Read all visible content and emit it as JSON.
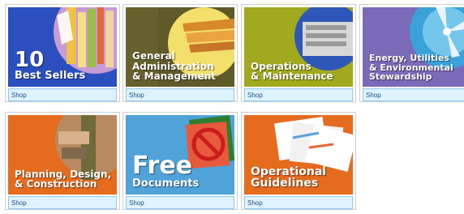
{
  "tiles": [
    {
      "line1": "10",
      "line2": "Best Sellers",
      "shop": "Shop",
      "bg": "#2b4fbf"
    },
    {
      "line1": "General",
      "line2": "Administration",
      "line3": "& Management",
      "shop": "Shop",
      "bg": "#5f5a2a"
    },
    {
      "line1": "Operations",
      "line2": "& Maintenance",
      "shop": "Shop",
      "bg": "#a1aa1f"
    },
    {
      "line1": "Energy, Utilities",
      "line2": "& Environmental",
      "line3": "Stewardship",
      "shop": "Shop",
      "bg": "#7a6ab8"
    },
    {
      "line1": "Planning, Design,",
      "line2": "& Construction",
      "shop": "Shop",
      "bg": "#e56b1f"
    },
    {
      "line1": "Free",
      "line2": "Documents",
      "shop": "Shop",
      "bg": "#4fa3d8"
    },
    {
      "line1": "Operational",
      "line2": "Guidelines",
      "shop": "Shop",
      "bg": "#e56b1f"
    }
  ]
}
